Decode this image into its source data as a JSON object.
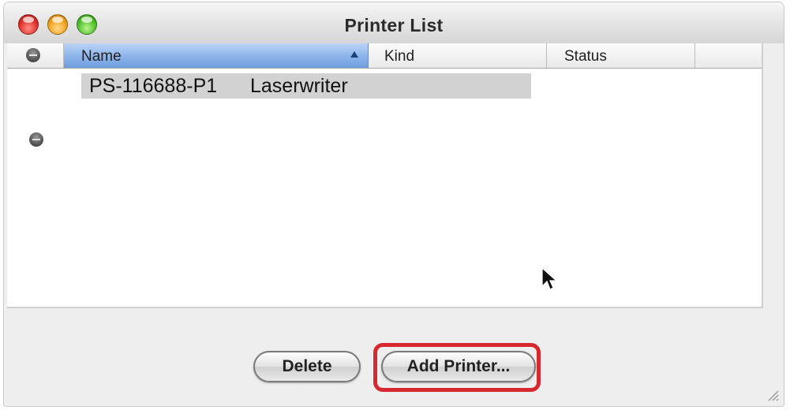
{
  "window": {
    "title": "Printer List"
  },
  "table": {
    "columns": [
      "Name",
      "Kind",
      "Status"
    ],
    "sorted_column": "Name",
    "sort_direction": "ascending",
    "rows": [
      {
        "name": "PS-116688-P1",
        "kind": "Laserwriter",
        "status": ""
      }
    ]
  },
  "buttons": {
    "delete": "Delete",
    "add_printer": "Add Printer..."
  },
  "icons": {
    "close": "close-traffic-light-icon",
    "minimize": "minimize-traffic-light-icon",
    "zoom": "zoom-traffic-light-icon",
    "cursor": "mouse-pointer-icon"
  },
  "colors": {
    "highlight": "#d8282f",
    "sorted_header": "#8fb6ea"
  }
}
